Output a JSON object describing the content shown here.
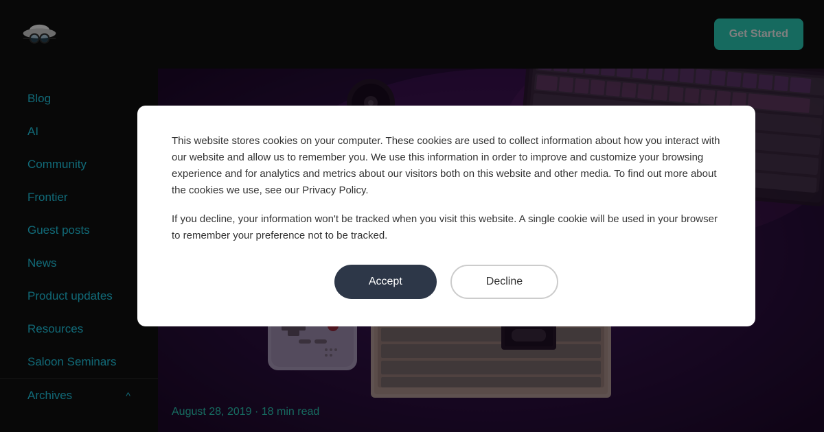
{
  "header": {
    "logo_alt": "Hat with glasses logo",
    "get_started_label": "Get Started"
  },
  "sidebar": {
    "nav_items": [
      {
        "id": "blog",
        "label": "Blog"
      },
      {
        "id": "ai",
        "label": "AI"
      },
      {
        "id": "community",
        "label": "Community"
      },
      {
        "id": "frontier",
        "label": "Frontier"
      },
      {
        "id": "guest-posts",
        "label": "Guest posts"
      },
      {
        "id": "news",
        "label": "News"
      },
      {
        "id": "product-updates",
        "label": "Product updates"
      },
      {
        "id": "resources",
        "label": "Resources"
      },
      {
        "id": "saloon-seminars",
        "label": "Saloon Seminars"
      }
    ],
    "archives_label": "Archives",
    "archives_chevron": "^"
  },
  "modal": {
    "text1": "This website stores cookies on your computer. These cookies are used to collect information about how you interact with our website and allow us to remember you. We use this information in order to improve and customize your browsing experience and for analytics and metrics about our visitors both on this website and other media. To find out more about the cookies we use, see our Privacy Policy.",
    "text2": "If you decline, your information won't be tracked when you visit this website. A single cookie will be used in your browser to remember your preference not to be tracked.",
    "accept_label": "Accept",
    "decline_label": "Decline"
  },
  "post": {
    "date": "August 28, 2019",
    "read_time": "18 min read",
    "meta_separator": "·"
  },
  "colors": {
    "accent": "#22d3ee",
    "button_bg": "#2dd4bf",
    "sidebar_bg": "#111111",
    "modal_accept_bg": "#2d3748"
  }
}
